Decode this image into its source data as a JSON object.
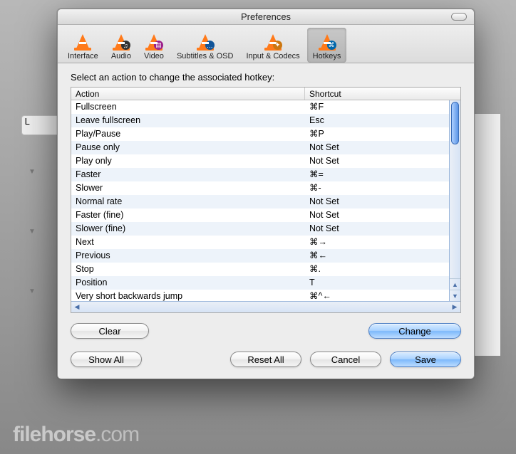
{
  "window": {
    "title": "Preferences"
  },
  "toolbar": {
    "items": [
      {
        "label": "Interface"
      },
      {
        "label": "Audio"
      },
      {
        "label": "Video"
      },
      {
        "label": "Subtitles & OSD"
      },
      {
        "label": "Input & Codecs"
      },
      {
        "label": "Hotkeys"
      }
    ],
    "selected_index": 5
  },
  "prompt": "Select an action to change the associated hotkey:",
  "columns": {
    "action": "Action",
    "shortcut": "Shortcut"
  },
  "hotkeys": [
    {
      "action": "Fullscreen",
      "shortcut": "⌘F"
    },
    {
      "action": "Leave fullscreen",
      "shortcut": "Esc"
    },
    {
      "action": "Play/Pause",
      "shortcut": "⌘P"
    },
    {
      "action": "Pause only",
      "shortcut": "Not Set"
    },
    {
      "action": "Play only",
      "shortcut": "Not Set"
    },
    {
      "action": "Faster",
      "shortcut": "⌘="
    },
    {
      "action": "Slower",
      "shortcut": "⌘-"
    },
    {
      "action": "Normal rate",
      "shortcut": "Not Set"
    },
    {
      "action": "Faster (fine)",
      "shortcut": "Not Set"
    },
    {
      "action": "Slower (fine)",
      "shortcut": "Not Set"
    },
    {
      "action": "Next",
      "shortcut": "⌘→"
    },
    {
      "action": "Previous",
      "shortcut": "⌘←"
    },
    {
      "action": "Stop",
      "shortcut": "⌘."
    },
    {
      "action": "Position",
      "shortcut": "T"
    },
    {
      "action": "Very short backwards jump",
      "shortcut": "⌘^←"
    }
  ],
  "buttons": {
    "clear": "Clear",
    "change": "Change",
    "show_all": "Show All",
    "reset_all": "Reset All",
    "cancel": "Cancel",
    "save": "Save"
  },
  "watermark": {
    "part1": "filehorse",
    "part2": ".com"
  }
}
